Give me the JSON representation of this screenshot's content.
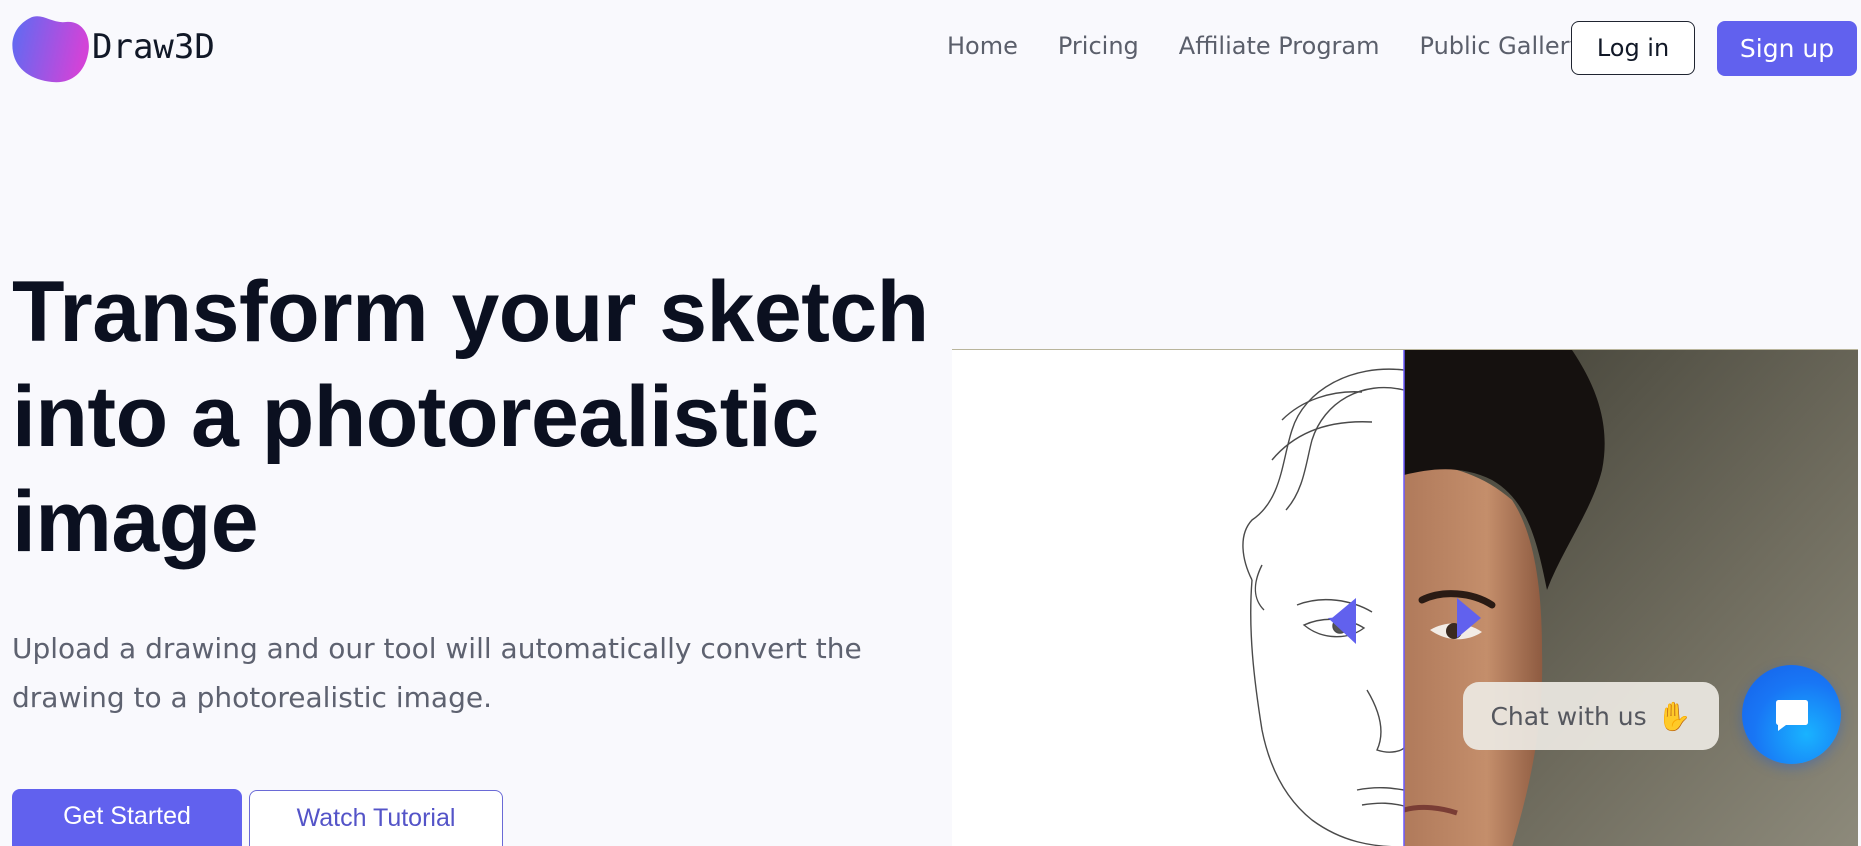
{
  "brand": {
    "name": "Draw3D",
    "logo_icon": "purple-blob-icon",
    "gradient": [
      "#5b6cf3",
      "#d243d8"
    ]
  },
  "nav": {
    "items": [
      {
        "label": "Home"
      },
      {
        "label": "Pricing"
      },
      {
        "label": "Affiliate Program"
      },
      {
        "label": "Public Gallery"
      }
    ],
    "login_label": "Log in",
    "signup_label": "Sign up"
  },
  "hero": {
    "title": "Transform your sketch into a photorealistic image",
    "subtitle": "Upload a drawing and our tool will automatically convert the drawing to a photorealistic image.",
    "primary_cta": "Get Started",
    "secondary_cta": "Watch Tutorial"
  },
  "comparison": {
    "left_icon": "arrow-left-icon",
    "right_icon": "arrow-right-icon",
    "handle_icon": "slider-handle-icon"
  },
  "chat": {
    "bubble_text": "Chat with us",
    "wave_icon": "waving-hand-icon",
    "button_icon": "chat-icon"
  },
  "colors": {
    "accent": "#6161ee",
    "background": "#f9f9fd",
    "chat_blue": "#1876f5"
  }
}
